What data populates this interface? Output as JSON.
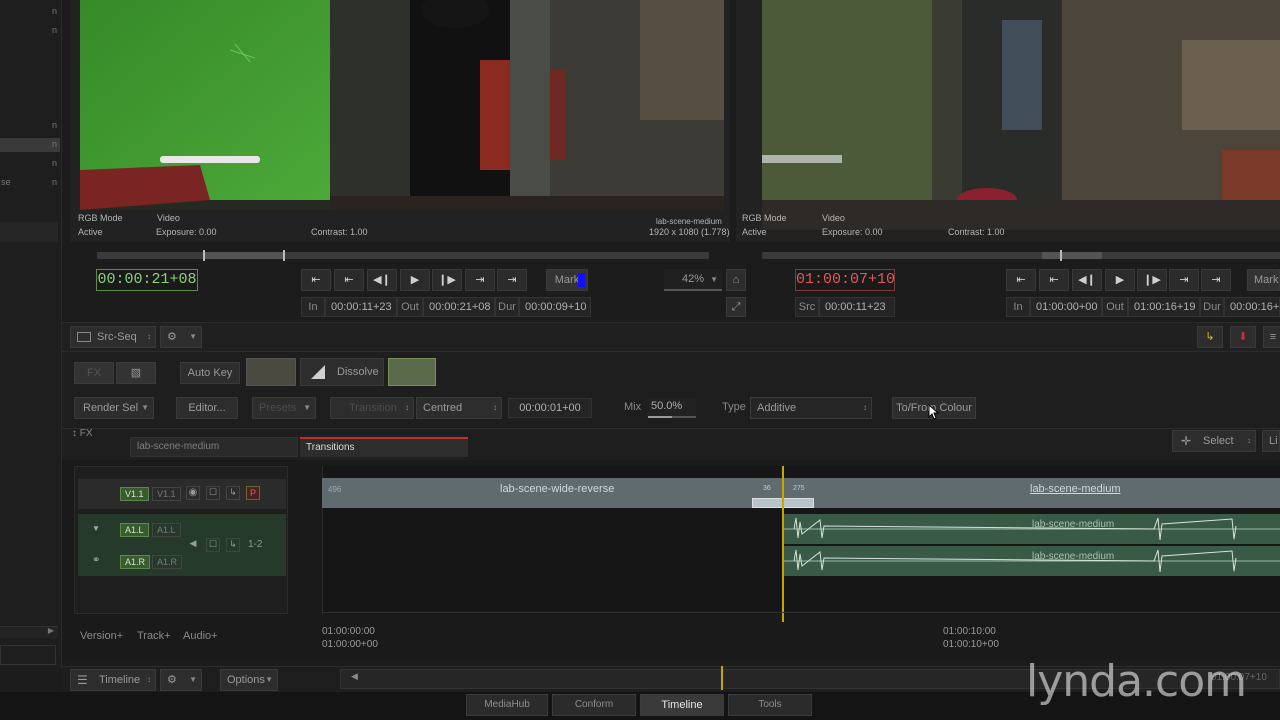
{
  "left_panel": {
    "n_marks": [
      "n",
      "n",
      "n",
      "n",
      "n",
      "n"
    ],
    "partial_label": "se"
  },
  "source_viewer": {
    "info": {
      "rgb_mode": "RGB Mode",
      "video": "Video",
      "active": "Active",
      "exposure": "Exposure: 0.00",
      "contrast": "Contrast: 1.00",
      "clip_name": "lab-scene-medium",
      "resolution": "1920 x 1080 (1.778)"
    },
    "timecode": "00:00:21+08",
    "in_label": "In",
    "in_value": "00:00:11+23",
    "out_label": "Out",
    "out_value": "00:00:21+08",
    "dur_label": "Dur",
    "dur_value": "00:00:09+10",
    "mark_label": "Mark",
    "zoom": "42%"
  },
  "record_viewer": {
    "info": {
      "rgb_mode": "RGB Mode",
      "video": "Video",
      "active": "Active",
      "exposure": "Exposure: 0.00",
      "contrast": "Contrast: 1.00"
    },
    "timecode": "01:00:07+10",
    "src_label": "Src",
    "src_value": "00:00:11+23",
    "in_label": "In",
    "in_value": "01:00:00+00",
    "out_label": "Out",
    "out_value": "01:00:16+19",
    "dur_label": "Dur",
    "dur_value": "00:00:16+",
    "mark_label": "Mark"
  },
  "toolbar": {
    "src_seq": "Src-Seq"
  },
  "fx_panel": {
    "fx_label": "FX",
    "auto_key": "Auto Key",
    "dissolve": "Dissolve",
    "render_sel": "Render Sel",
    "editor": "Editor...",
    "presets": "Presets",
    "transition": "Transition",
    "centred": "Centred",
    "duration": "00:00:01+00",
    "mix_label": "Mix",
    "mix_value": "50.0%",
    "mix_level": 0.5,
    "type_label": "Type",
    "type_value": "Additive",
    "to_from_colour": "To/From Colour"
  },
  "timeline_tabs": {
    "fx": "FX",
    "clip_tab": "lab-scene-medium",
    "transitions_tab": "Transitions",
    "select": "Select",
    "partial": "Li"
  },
  "tracks": {
    "v1_active": "V1.1",
    "v1_name": "V1.1",
    "p": "P",
    "a1l_active": "A1.L",
    "a1l_name": "A1.L",
    "a1_chan": "1-2",
    "a1r_active": "A1.R",
    "a1r_name": "A1.R"
  },
  "clips": {
    "left_clip": "lab-scene-wide-reverse",
    "left_frame": "496",
    "right_clip": "lab-scene-medium",
    "trans_left": "36",
    "trans_right": "275",
    "audio_top": "lab-scene-medium",
    "audio_bottom": "lab-scene-medium"
  },
  "ruler": {
    "t1_a": "01:00:00:00",
    "t1_b": "01:00:00+00",
    "t2_a": "01:00:10:00",
    "t2_b": "01:00:10+00"
  },
  "track_buttons": {
    "version": "Version+",
    "track": "Track+",
    "audio": "Audio+"
  },
  "bottom_bar": {
    "timeline": "Timeline",
    "options": "Options",
    "tc_partial": "01:00:07+10"
  },
  "bottom_tabs": {
    "mediahub": "MediaHub",
    "conform": "Conform",
    "timeline": "Timeline",
    "tools": "Tools"
  },
  "watermark": "lynda.com",
  "colors": {
    "accent_green": "#8cd07a",
    "accent_red": "#e05a5a",
    "mark_blue": "#1010ff",
    "playhead": "#c8a600"
  }
}
